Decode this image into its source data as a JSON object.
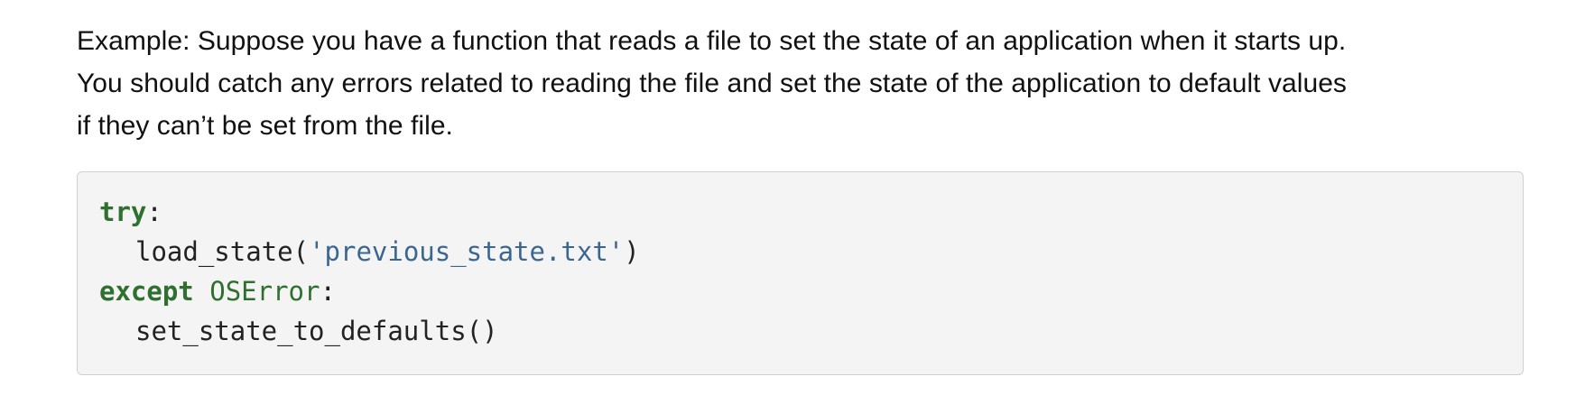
{
  "paragraph": {
    "lines": [
      "Example: Suppose you have a function that reads a file to set the state of an application when it starts up.",
      "You should catch any errors related to reading the file and set the state of the application to default values",
      "if they can’t be set from the file."
    ]
  },
  "code": {
    "line1": {
      "keyword": "try",
      "punct": ":"
    },
    "line2": {
      "func": "load_state(",
      "string": "'previous_state.txt'",
      "close": ")"
    },
    "line3": {
      "keyword": "except",
      "space": " ",
      "exception": "OSError",
      "punct": ":"
    },
    "line4": {
      "call": "set_state_to_defaults()"
    }
  },
  "colors": {
    "keyword": "#2f6f2f",
    "string": "#3a6690",
    "code_background": "#f4f4f4",
    "code_border": "#cfcfcf",
    "text": "#111111"
  }
}
